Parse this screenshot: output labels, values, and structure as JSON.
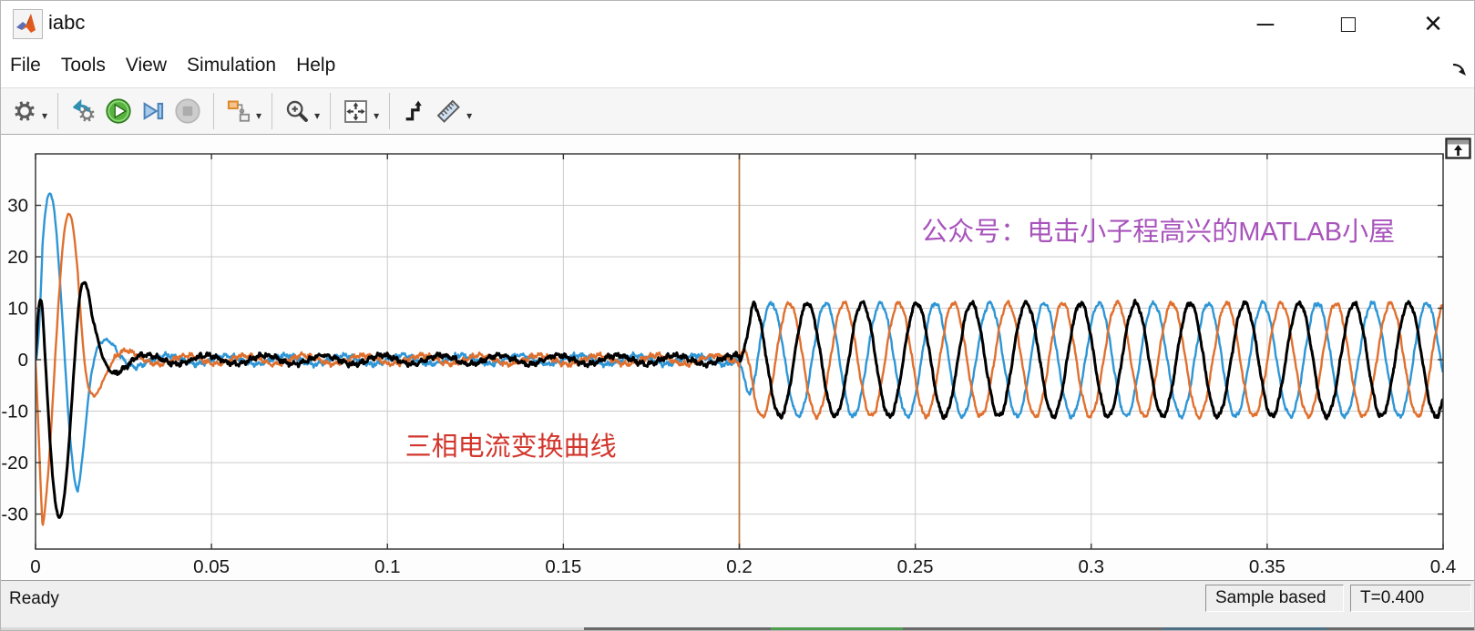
{
  "window": {
    "title": "iabc",
    "controls": {
      "minimize": "─",
      "maximize": "□",
      "close": "×"
    }
  },
  "menu": {
    "items": [
      "File",
      "Tools",
      "View",
      "Simulation",
      "Help"
    ]
  },
  "toolbar": {
    "groups": [
      {
        "buttons": [
          {
            "icon": "settings-gear",
            "caret": true
          }
        ]
      },
      {
        "buttons": [
          {
            "icon": "goto-block"
          },
          {
            "icon": "run"
          },
          {
            "icon": "step-forward"
          },
          {
            "icon": "stop",
            "disabled": true
          }
        ]
      },
      {
        "buttons": [
          {
            "icon": "signal-selector",
            "caret": true
          }
        ]
      },
      {
        "buttons": [
          {
            "icon": "zoom-in",
            "caret": true
          }
        ]
      },
      {
        "buttons": [
          {
            "icon": "fit-to-view",
            "caret": true
          }
        ]
      },
      {
        "buttons": [
          {
            "icon": "trigger"
          },
          {
            "icon": "measurements",
            "caret": true
          }
        ]
      }
    ]
  },
  "statusbar": {
    "ready": "Ready",
    "sample_mode": "Sample based",
    "sim_time": "T=0.400"
  },
  "chart_data": {
    "type": "line",
    "title": "Three-phase current scope trace",
    "xlim": [
      0,
      0.4
    ],
    "ylim": [
      -36.8,
      40
    ],
    "grid": true,
    "x_ticks": {
      "values": [
        0,
        0.05,
        0.1,
        0.15,
        0.2,
        0.25,
        0.3,
        0.35,
        0.4
      ],
      "labels": [
        "0",
        "0.05",
        "0.1",
        "0.15",
        "0.2",
        "0.25",
        "0.3",
        "0.35",
        "0.4"
      ]
    },
    "y_ticks": {
      "values": [
        30,
        20,
        10,
        0,
        -10,
        -20,
        -30
      ],
      "labels": [
        "30",
        "20",
        "10",
        "0",
        "-10",
        "-20",
        "-30"
      ]
    },
    "series": [
      {
        "name": "phase-b-blue",
        "color": "#2E96D6",
        "width": 2.4,
        "transient_phase_deg": 0,
        "steady_phase_deg": -120,
        "seed": 11
      },
      {
        "name": "phase-c-orange",
        "color": "#E0702E",
        "width": 2.4,
        "transient_phase_deg": -120,
        "steady_phase_deg": 120,
        "seed": 22
      },
      {
        "name": "phase-a-black",
        "color": "#000000",
        "width": 3.0,
        "transient_phase_deg": 120,
        "steady_phase_deg": 0,
        "seed": 33
      }
    ],
    "waveform_model": {
      "transient": {
        "freq_hz": 60,
        "ramp_s": 0.002,
        "envelope": [
          [
            0,
            34
          ],
          [
            0.005,
            32
          ],
          [
            0.009,
            29
          ],
          [
            0.012,
            26
          ],
          [
            0.0135,
            19
          ],
          [
            0.016,
            9
          ],
          [
            0.019,
            4.5
          ],
          [
            0.024,
            2.2
          ],
          [
            0.032,
            0.85
          ]
        ],
        "noise_scale_large": 0.22,
        "noise_scale_quiet": 0.5
      },
      "steady": {
        "start_s": 0.2,
        "amplitude": 11,
        "freq_hz": 64.4,
        "ramp_s": 0.004,
        "noise_scale": 0.45
      },
      "event_line": {
        "time_s": 0.2,
        "color": "#BF7B3C"
      }
    },
    "annotations": [
      {
        "name": "red-label",
        "text": "三相电流变换曲线",
        "color": "#D2352B",
        "x_s": 0.105,
        "y_val": -16.8,
        "font_px": 29
      },
      {
        "name": "purple-label",
        "text": "公众号：电击小子程高兴的MATLAB小屋",
        "color": "#A854BC",
        "x_s": 0.2517,
        "y_val": 25,
        "font_px": 29
      }
    ]
  }
}
